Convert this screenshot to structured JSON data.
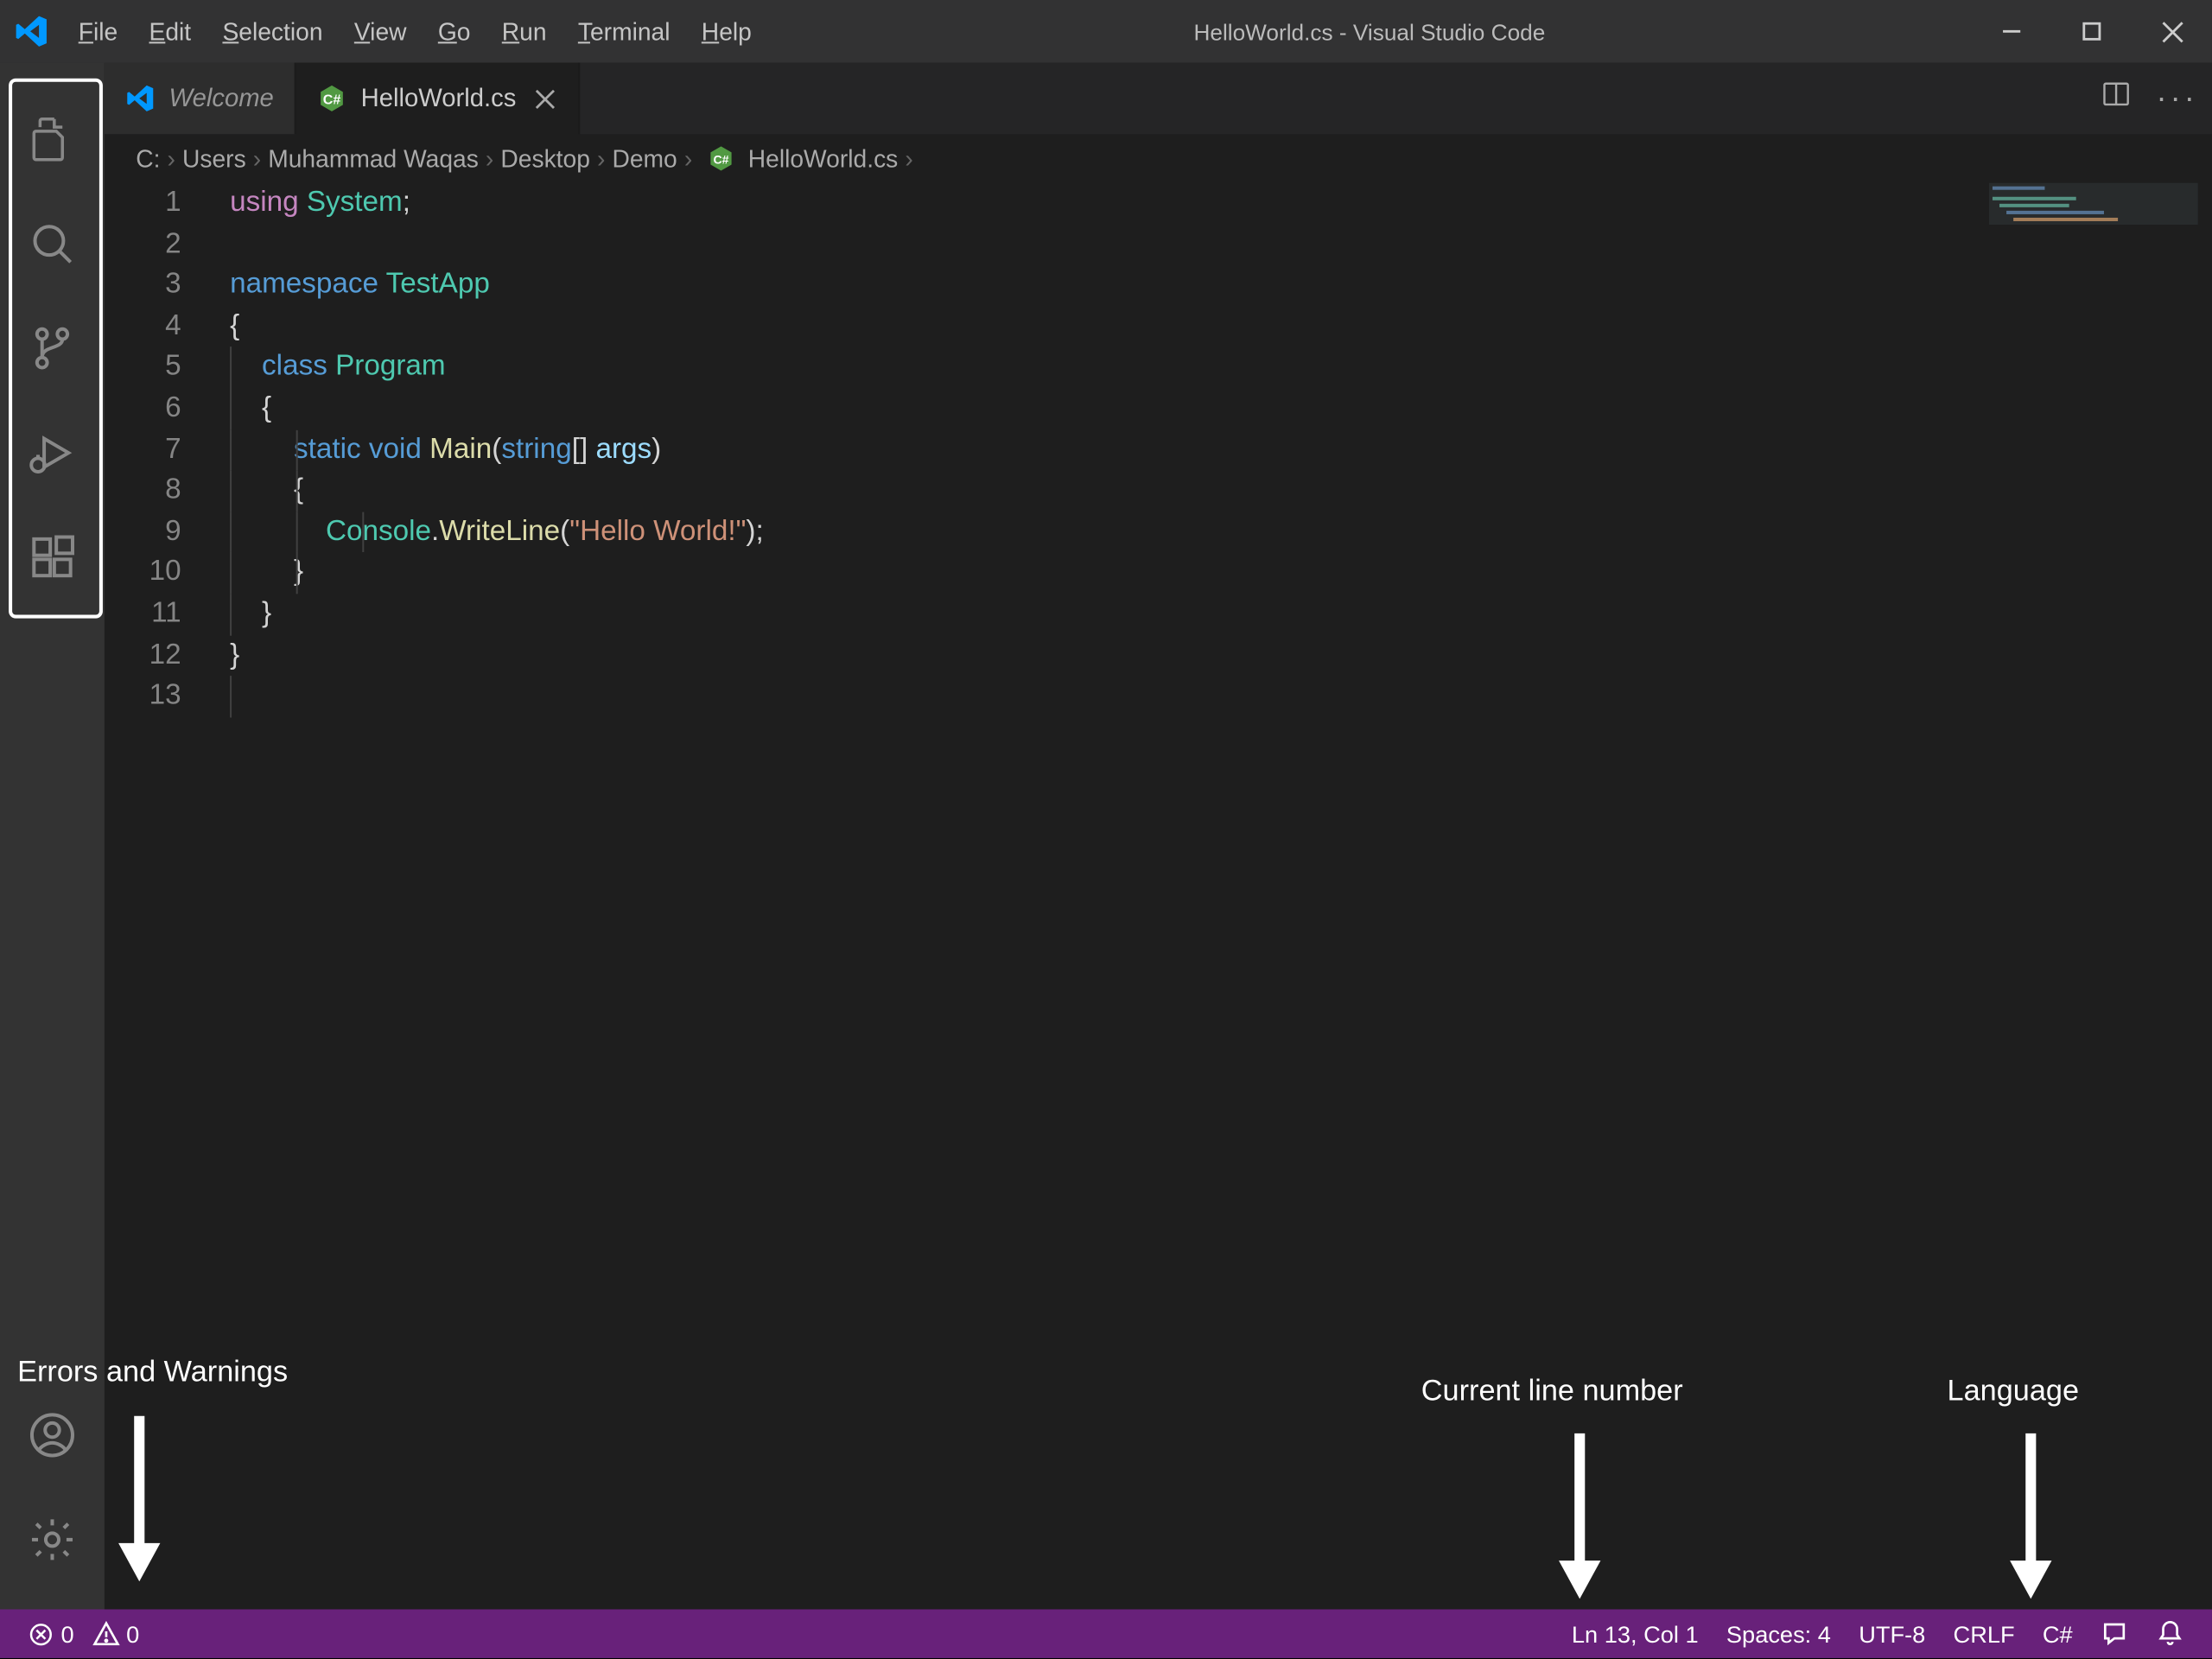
{
  "title": "HelloWorld.cs - Visual Studio Code",
  "menu": [
    "File",
    "Edit",
    "Selection",
    "View",
    "Go",
    "Run",
    "Terminal",
    "Help"
  ],
  "tabs": [
    {
      "label": "Welcome",
      "active": false,
      "italic": true,
      "icon": "vscode"
    },
    {
      "label": "HelloWorld.cs",
      "active": true,
      "icon": "csharp"
    }
  ],
  "breadcrumbs": [
    "C:",
    "Users",
    "Muhammad Waqas",
    "Desktop",
    "Demo",
    "HelloWorld.cs"
  ],
  "code": {
    "lines": [
      {
        "n": 1,
        "tokens": [
          [
            "using ",
            "keyword2"
          ],
          [
            "System",
            "class"
          ],
          [
            ";",
            "punc"
          ]
        ]
      },
      {
        "n": 2,
        "tokens": []
      },
      {
        "n": 3,
        "tokens": [
          [
            "namespace ",
            "keyword"
          ],
          [
            "TestApp",
            "class"
          ]
        ]
      },
      {
        "n": 4,
        "tokens": [
          [
            "{",
            "punc"
          ]
        ]
      },
      {
        "n": 5,
        "tokens": [
          [
            "    ",
            ""
          ],
          [
            "class ",
            "keyword"
          ],
          [
            "Program",
            "class"
          ]
        ],
        "guides": [
          0
        ]
      },
      {
        "n": 6,
        "tokens": [
          [
            "    {",
            "punc"
          ]
        ],
        "guides": [
          0
        ]
      },
      {
        "n": 7,
        "tokens": [
          [
            "        ",
            ""
          ],
          [
            "static ",
            "keyword"
          ],
          [
            "void ",
            "keyword"
          ],
          [
            "Main",
            "method"
          ],
          [
            "(",
            "punc"
          ],
          [
            "string",
            "keyword"
          ],
          [
            "[] ",
            "punc"
          ],
          [
            "args",
            "var"
          ],
          [
            ")",
            "punc"
          ]
        ],
        "guides": [
          0,
          1
        ]
      },
      {
        "n": 8,
        "tokens": [
          [
            "        {",
            "punc"
          ]
        ],
        "guides": [
          0,
          1
        ]
      },
      {
        "n": 9,
        "tokens": [
          [
            "            ",
            ""
          ],
          [
            "Console",
            "class"
          ],
          [
            ".",
            "punc"
          ],
          [
            "WriteLine",
            "method"
          ],
          [
            "(",
            "punc"
          ],
          [
            "\"Hello World!\"",
            "string"
          ],
          [
            ");",
            "punc"
          ]
        ],
        "guides": [
          0,
          1,
          2
        ]
      },
      {
        "n": 10,
        "tokens": [
          [
            "        }",
            "punc"
          ]
        ],
        "guides": [
          0,
          1
        ]
      },
      {
        "n": 11,
        "tokens": [
          [
            "    }",
            "punc"
          ]
        ],
        "guides": [
          0
        ]
      },
      {
        "n": 12,
        "tokens": [
          [
            "}",
            "punc"
          ]
        ]
      },
      {
        "n": 13,
        "tokens": [],
        "guides": [
          0
        ]
      }
    ]
  },
  "statusbar": {
    "errors": "0",
    "warnings": "0",
    "line_col": "Ln 13, Col 1",
    "spaces": "Spaces: 4",
    "encoding": "UTF-8",
    "eol": "CRLF",
    "lang": "C#"
  },
  "annotations": {
    "errors_warnings": "Errors and Warnings",
    "line_num": "Current line number",
    "language": "Language"
  }
}
